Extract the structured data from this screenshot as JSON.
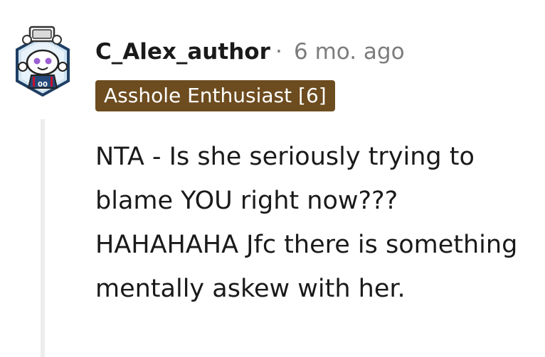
{
  "comment": {
    "author": "C_Alex_author",
    "separator": "·",
    "timestamp": "6 mo. ago",
    "flair": "Asshole Enthusiast [6]",
    "body": "NTA - Is she seriously trying to blame YOU right now??? HAHAHAHA Jfc there is something mentally askew with her."
  },
  "avatar": {
    "icon": "snoo-avatar-icon",
    "jersey_text": "00"
  },
  "colors": {
    "flair_bg": "#6d4c1f",
    "flair_text": "#ffffff",
    "meta_gray": "#7c7c7c",
    "thread_line": "#ededed",
    "text": "#1a1a1b"
  }
}
